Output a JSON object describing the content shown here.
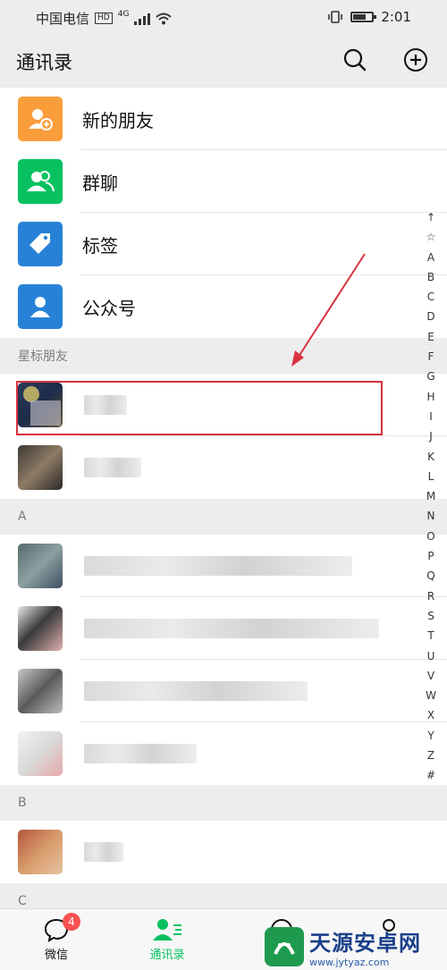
{
  "status": {
    "carrier": "中国电信",
    "hd": "HD",
    "net": "4G",
    "time": "2:01"
  },
  "header": {
    "title": "通讯录"
  },
  "features": [
    {
      "label": "新的朋友",
      "color": "#fa9d3b",
      "icon": "add-friend-icon"
    },
    {
      "label": "群聊",
      "color": "#07c160",
      "icon": "group-icon"
    },
    {
      "label": "标签",
      "color": "#2782d7",
      "icon": "tag-icon"
    },
    {
      "label": "公众号",
      "color": "#2782d7",
      "icon": "official-account-icon"
    }
  ],
  "sections": {
    "starred": "星标朋友",
    "a": "A",
    "b": "B",
    "c": "C"
  },
  "alpha_index": [
    "↑",
    "☆",
    "A",
    "B",
    "C",
    "D",
    "E",
    "F",
    "G",
    "H",
    "I",
    "J",
    "K",
    "L",
    "M",
    "N",
    "O",
    "P",
    "Q",
    "R",
    "S",
    "T",
    "U",
    "V",
    "W",
    "X",
    "Y",
    "Z",
    "#"
  ],
  "tabs": [
    {
      "label": "微信",
      "badge": "4",
      "icon": "chat-icon"
    },
    {
      "label": "通讯录",
      "icon": "contacts-icon",
      "active": true
    }
  ],
  "watermark": {
    "main": "天源安卓网",
    "sub": "www.jytyaz.com"
  },
  "colors": {
    "accent": "#07c160",
    "highlight": "#d9333f",
    "badge": "#fa5151"
  }
}
